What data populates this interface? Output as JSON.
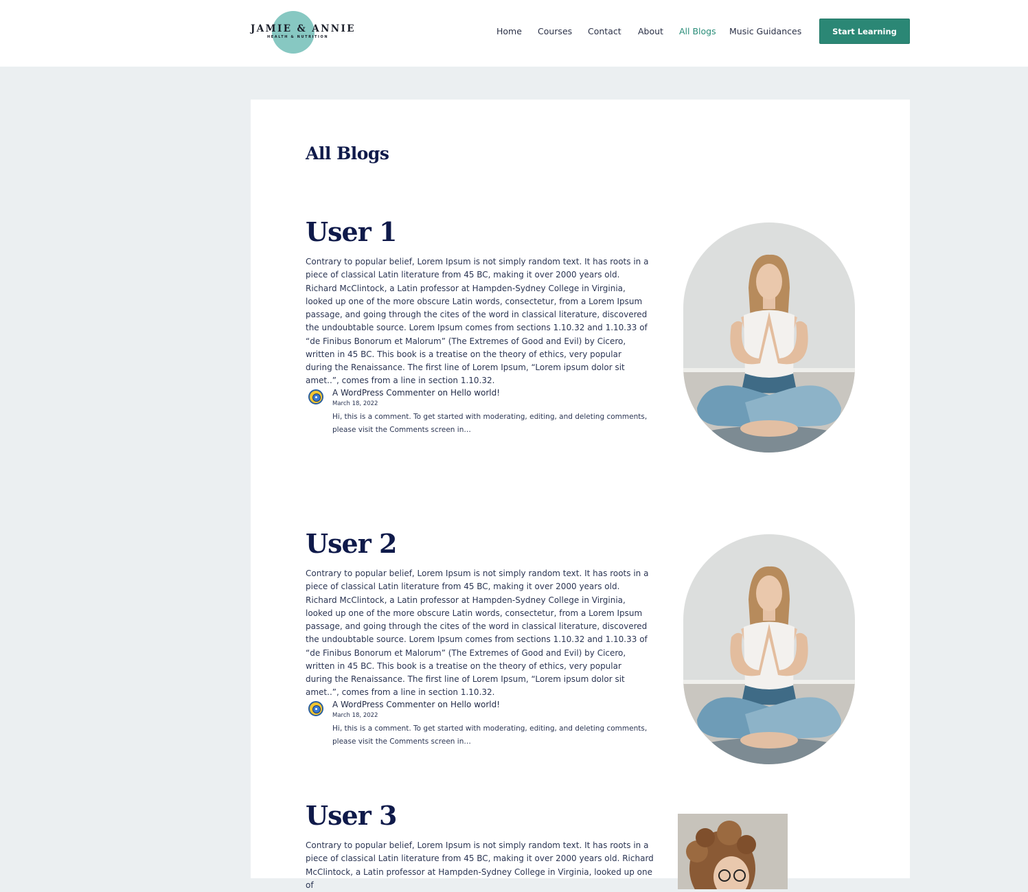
{
  "brand": {
    "name": "JAMIE & ANNIE",
    "tagline": "HEALTH & NUTRITION",
    "accent_color": "#2b8775",
    "logo_color": "#87c8c2",
    "title_color": "#0f1a4a"
  },
  "nav": {
    "items": [
      {
        "label": "Home"
      },
      {
        "label": "Courses"
      },
      {
        "label": "Contact"
      },
      {
        "label": "About"
      },
      {
        "label": "All Blogs",
        "active": true
      },
      {
        "label": "Music Guidances"
      }
    ],
    "cta_label": "Start Learning"
  },
  "page": {
    "title": "All Blogs"
  },
  "posts": [
    {
      "title": "User 1",
      "body": "Contrary to popular belief, Lorem Ipsum is not simply random text. It has roots in a piece of classical Latin literature from 45 BC, making it over 2000 years old. Richard McClintock, a Latin professor at Hampden-Sydney College in Virginia, looked up one of the more obscure Latin words, consectetur, from a Lorem Ipsum passage, and going through the cites of the word in classical literature, discovered the undoubtable source. Lorem Ipsum comes from sections 1.10.32 and 1.10.33 of “de Finibus Bonorum et Malorum” (The Extremes of Good and Evil) by Cicero, written in 45 BC. This book is a treatise on the theory of ethics, very popular during the Renaissance. The first line of Lorem Ipsum, “Lorem ipsum dolor sit amet..”, comes from a line in section 1.10.32.",
      "comment": {
        "author": "A WordPress Commenter",
        "connector": "on",
        "post_link": "Hello world!",
        "date": "March 18, 2022",
        "excerpt": "Hi, this is a comment. To get started with moderating, editing, and deleting comments, please visit the Comments screen in…"
      },
      "image": "yoga-woman-meditating-photo"
    },
    {
      "title": "User 2",
      "body": "Contrary to popular belief, Lorem Ipsum is not simply random text. It has roots in a piece of classical Latin literature from 45 BC, making it over 2000 years old. Richard McClintock, a Latin professor at Hampden-Sydney College in Virginia, looked up one of the more obscure Latin words, consectetur, from a Lorem Ipsum passage, and going through the cites of the word in classical literature, discovered the undoubtable source. Lorem Ipsum comes from sections 1.10.32 and 1.10.33 of “de Finibus Bonorum et Malorum” (The Extremes of Good and Evil) by Cicero, written in 45 BC. This book is a treatise on the theory of ethics, very popular during the Renaissance. The first line of Lorem Ipsum, “Lorem ipsum dolor sit amet..”, comes from a line in section 1.10.32.",
      "comment": {
        "author": "A WordPress Commenter",
        "connector": "on",
        "post_link": "Hello world!",
        "date": "March 18, 2022",
        "excerpt": "Hi, this is a comment. To get started with moderating, editing, and deleting comments, please visit the Comments screen in…"
      },
      "image": "yoga-woman-meditating-photo"
    },
    {
      "title": "User 3",
      "body": "Contrary to popular belief, Lorem Ipsum is not simply random text. It has roots in a piece of classical Latin literature from 45 BC, making it over 2000 years old. Richard McClintock, a Latin professor at Hampden-Sydney College in Virginia, looked up one of",
      "image": "curly-haired-woman-glasses-photo"
    }
  ]
}
